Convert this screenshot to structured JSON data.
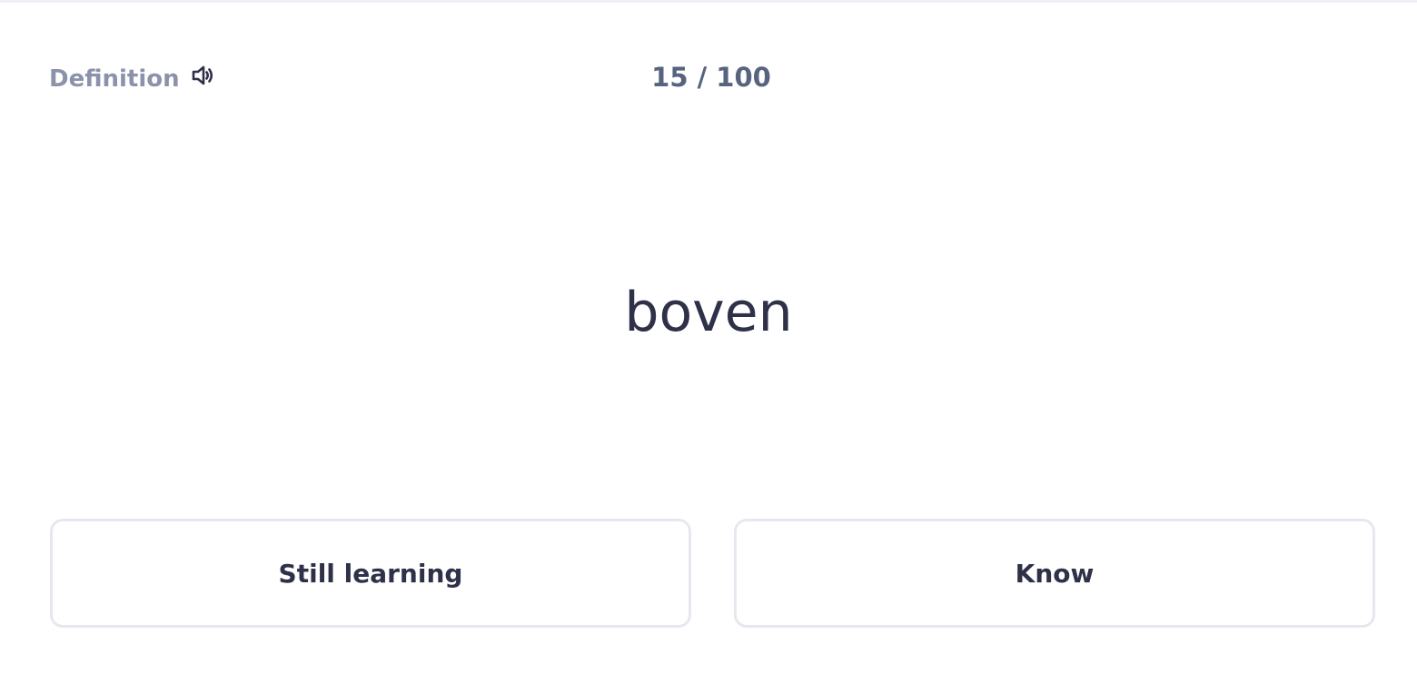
{
  "card": {
    "side_label": "Definition",
    "audio_icon": "speaker-icon",
    "progress": "15 / 100",
    "term": "boven"
  },
  "actions": {
    "still_learning_label": "Still learning",
    "know_label": "Know"
  },
  "colors": {
    "label_gray": "#8b93ab",
    "counter_gray": "#586380",
    "text_dark": "#2e3148",
    "border": "#e7e8ef"
  }
}
